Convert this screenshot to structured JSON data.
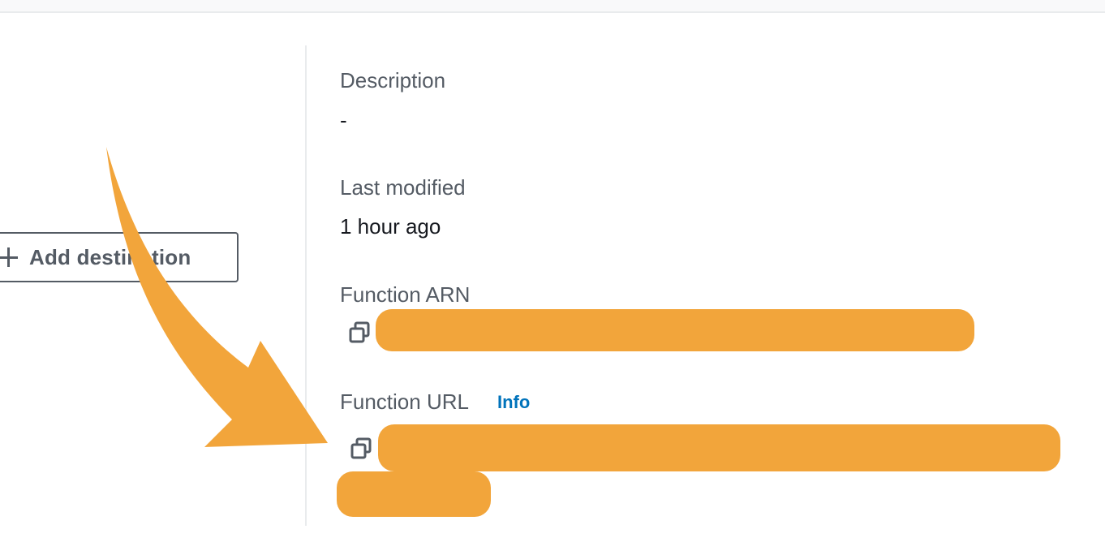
{
  "left_panel": {
    "add_destination_label": "Add destination"
  },
  "details": {
    "description_label": "Description",
    "description_value": "-",
    "last_modified_label": "Last modified",
    "last_modified_value": "1 hour ago",
    "function_arn_label": "Function ARN",
    "function_url_label": "Function URL",
    "info_link": "Info"
  },
  "icons": {
    "plus": "plus-icon",
    "copy": "copy-icon"
  },
  "colors": {
    "annotation_orange": "#f2a53b",
    "info_link_blue": "#0073bb",
    "label_gray": "#545b64",
    "text_dark": "#16191f",
    "divider": "#e9ebed"
  }
}
